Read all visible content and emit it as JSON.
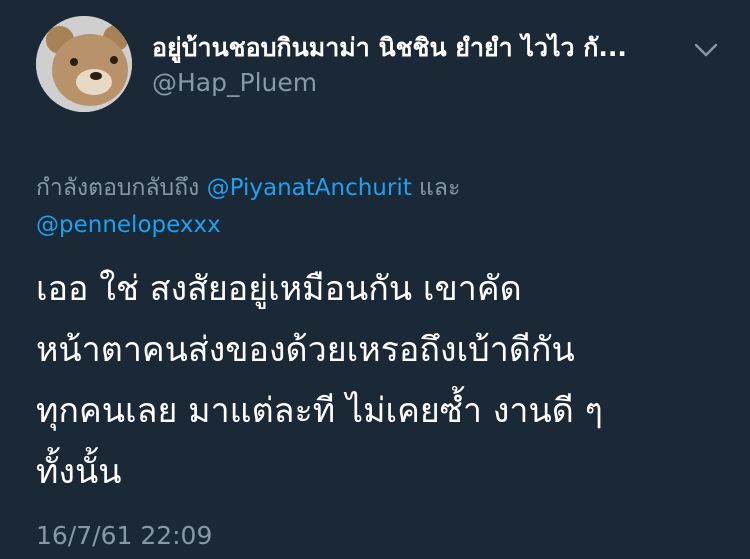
{
  "tweet": {
    "author": {
      "display_name": "อยู่บ้านชอบกินมาม่า นิชชิน ยำยำ ไวไว กั...",
      "handle": "@Hap_Pluem",
      "avatar_icon": "teddy-bear-avatar-icon"
    },
    "menu_icon": "chevron-down-icon",
    "reply_context": {
      "prefix": "กำลังตอบกลับถึง ",
      "mention_1": "@PiyanatAnchurit",
      "conjunction": " และ ",
      "mention_2": "@pennelopexxx"
    },
    "text_lines": [
      "เออ ใช่ สงสัยอยู่เหมือนกัน เขาคัด",
      "หน้าตาคนส่งของด้วยเหรอถึงเบ้าดีกัน",
      "ทุกคนเลย มาแต่ละที ไม่เคยซ้ำ งานดี ๆ",
      "ทั้งนั้น"
    ],
    "timestamp": "16/7/61 22:09"
  },
  "colors": {
    "background": "#1b2836",
    "primary_text": "#ffffff",
    "secondary_text": "#8899a6",
    "link": "#1da1f2"
  }
}
